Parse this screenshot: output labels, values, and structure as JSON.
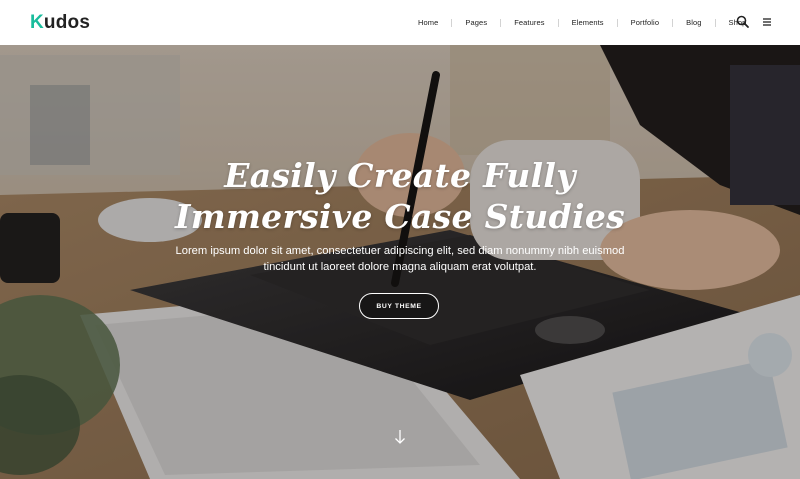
{
  "brand": {
    "logo_first": "K",
    "logo_rest": "udos"
  },
  "nav": {
    "items": [
      "Home",
      "Pages",
      "Features",
      "Elements",
      "Portfolio",
      "Blog",
      "Shop"
    ]
  },
  "icons": {
    "search": "search-icon",
    "menu": "hamburger-menu-icon",
    "scroll": "arrow-down-icon"
  },
  "hero": {
    "title_line1": "Easily Create Fully",
    "title_line2": "Immersive Case Studies",
    "subtitle_line1": "Lorem ipsum dolor sit amet, consectetuer adipiscing elit, sed diam nonummy nibh euismod",
    "subtitle_line2": "tincidunt ut laoreet dolore magna aliquam erat volutpat.",
    "cta_label": "BUY THEME"
  },
  "colors": {
    "accent": "#1abc9c",
    "text": "#222222",
    "header_bg": "#ffffff"
  }
}
